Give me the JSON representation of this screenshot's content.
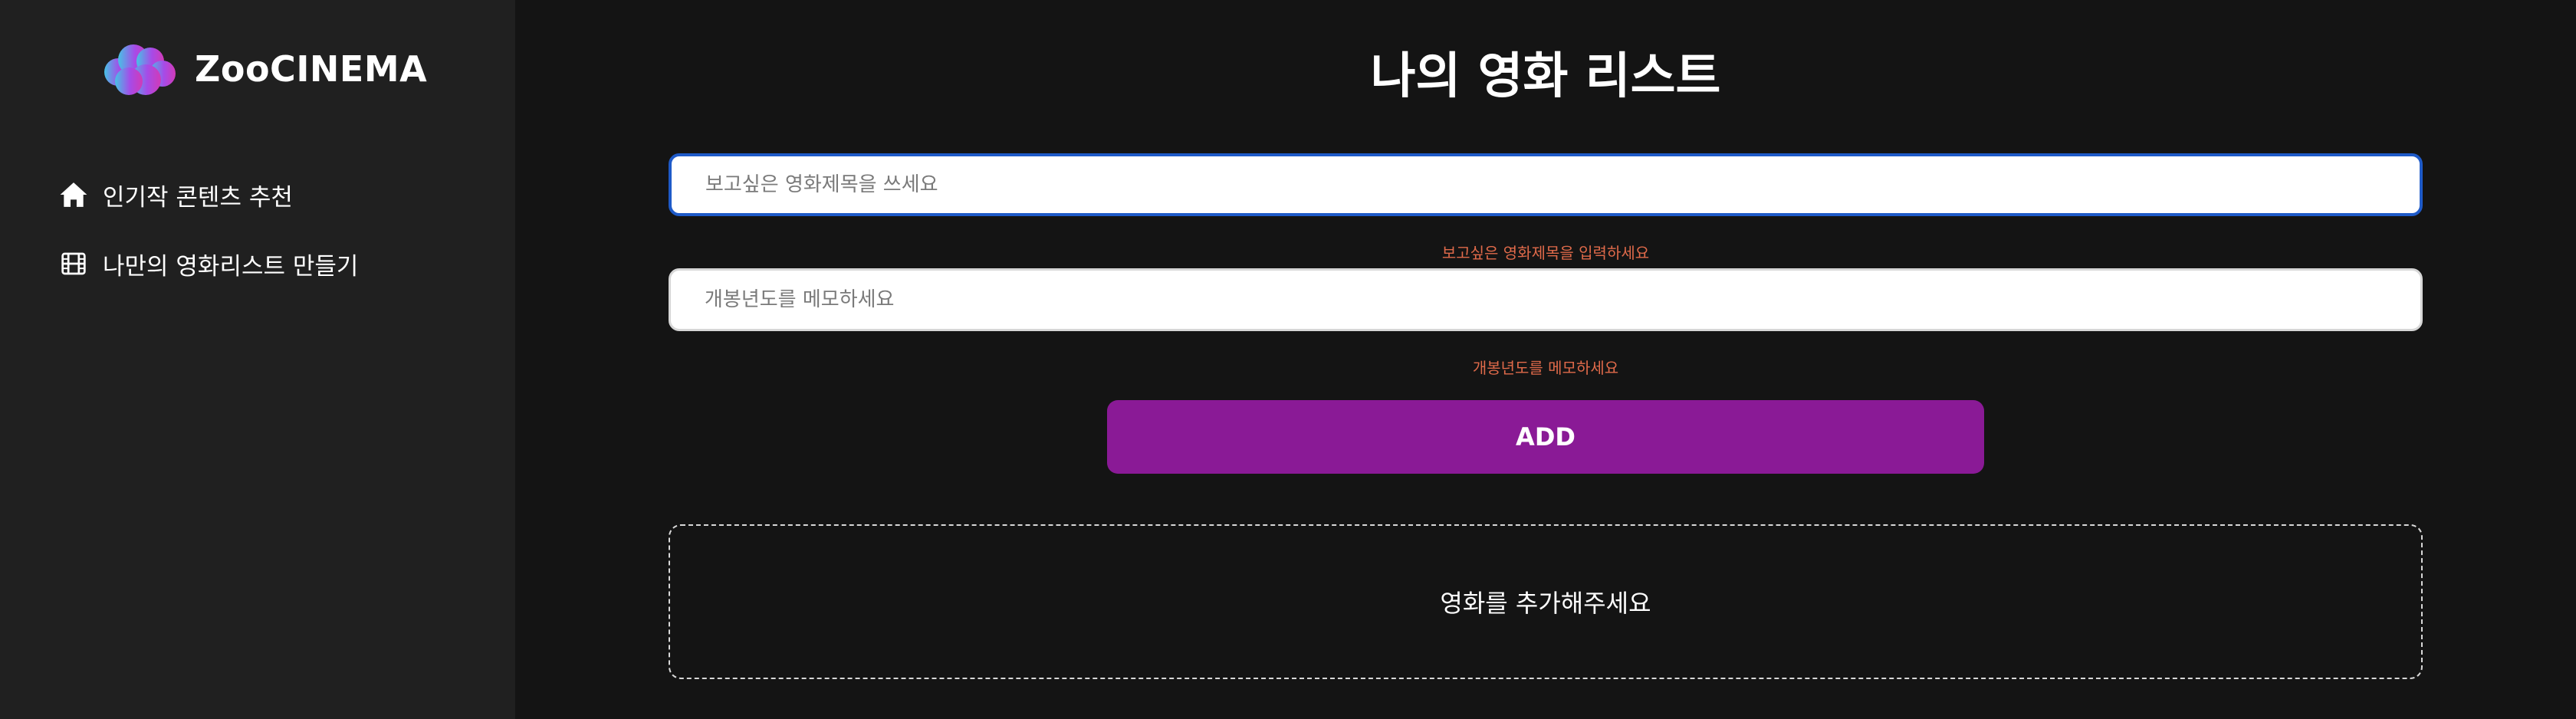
{
  "brand": {
    "name": "ZooCINEMA",
    "logo_gradient": [
      "#46c2e6",
      "#a64be8",
      "#d13ab7"
    ]
  },
  "sidebar": {
    "items": [
      {
        "label": "인기작 콘텐츠 추천",
        "icon": "home-icon"
      },
      {
        "label": "나만의 영화리스트 만들기",
        "icon": "film-icon"
      }
    ]
  },
  "main": {
    "title": "나의 영화 리스트",
    "title_input": {
      "value": "",
      "placeholder": "보고싶은 영화제목을 쓰세요",
      "error": "보고싶은 영화제목을 입력하세요"
    },
    "year_input": {
      "value": "",
      "placeholder": "개봉년도를 메모하세요",
      "error": "개봉년도를 메모하세요"
    },
    "add_button": "ADD",
    "empty_message": "영화를 추가해주세요"
  },
  "colors": {
    "sidebar_bg": "#202020",
    "main_bg": "#141414",
    "accent": "#8a1a96",
    "error": "#e06a4a",
    "focus": "#1e5ac8"
  }
}
